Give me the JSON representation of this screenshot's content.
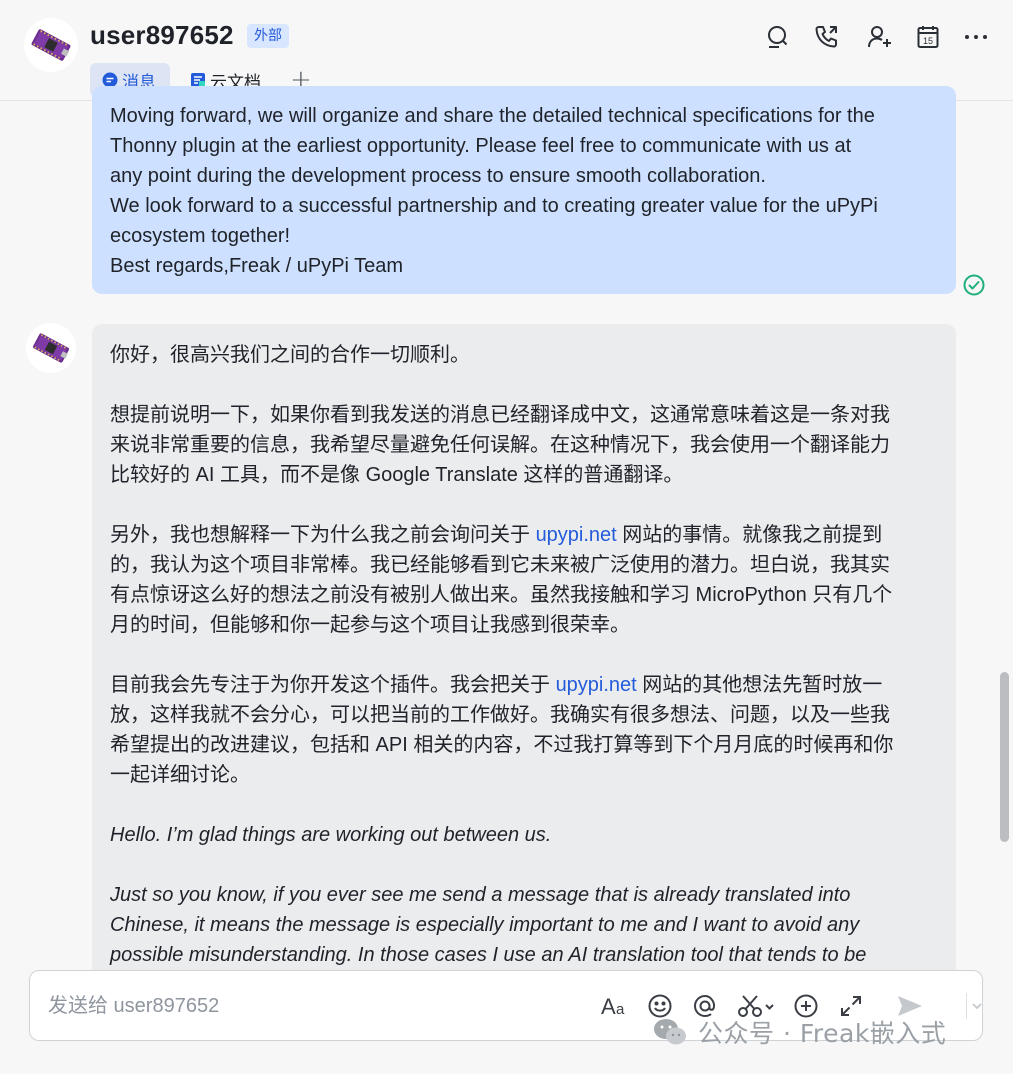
{
  "header": {
    "title": "user897652",
    "badge": "外部",
    "tabs": [
      {
        "label": "消息",
        "icon": "message-icon",
        "active": true
      },
      {
        "label": "云文档",
        "icon": "doc-icon",
        "active": false
      }
    ],
    "actions": [
      "search-icon",
      "phone-icon",
      "add-member-icon",
      "calendar-icon",
      "more-icon"
    ],
    "calendar_day": "15"
  },
  "own_message": {
    "lines": [
      "Moving forward, we will organize and share the detailed technical specifications for the",
      "Thonny plugin at the earliest opportunity. Please feel free to communicate with us at",
      "any point during the development process to ensure smooth collaboration.",
      "We look forward to a successful partnership and to creating greater value for the uPyPi",
      "ecosystem together!",
      "Best regards,Freak / uPyPi Team"
    ],
    "status": "read"
  },
  "other_message": {
    "p1": "你好，很高兴我们之间的合作一切顺利。",
    "p2_l1": "想提前说明一下，如果你看到我发送的消息已经翻译成中文，这通常意味着这是一条对我",
    "p2_l2": "来说非常重要的信息，我希望尽量避免任何误解。在这种情况下，我会使用一个翻译能力",
    "p2_l3": "比较好的 AI 工具，而不是像 Google Translate 这样的普通翻译。",
    "p3_l1_a": "另外，我也想解释一下为什么我之前会询问关于 ",
    "p3_l1_link": "upypi.net",
    "p3_l1_b": " 网站的事情。就像我之前提到",
    "p3_l2": "的，我认为这个项目非常棒。我已经能够看到它未来被广泛使用的潜力。坦白说，我其实",
    "p3_l3": "有点惊讶这么好的想法之前没有被别人做出来。虽然我接触和学习 MicroPython 只有几个",
    "p3_l4": "月的时间，但能够和你一起参与这个项目让我感到很荣幸。",
    "p4_l1_a": "目前我会先专注于为你开发这个插件。我会把关于 ",
    "p4_l1_link": "upypi.net",
    "p4_l1_b": " 网站的其他想法先暂时放一",
    "p4_l2": "放，这样我就不会分心，可以把当前的工作做好。我确实有很多想法、问题，以及一些我",
    "p4_l3": "希望提出的改进建议，包括和 API 相关的内容，不过我打算等到下个月月底的时候再和你",
    "p4_l4": "一起详细讨论。",
    "en_p1": "Hello. I’m glad things are working out between us.",
    "en_p2_l1": "Just so you know, if you ever see me send a message that is already translated into",
    "en_p2_l2": "Chinese, it means the message is especially important to me and I want to avoid any",
    "en_p2_l3": "possible misunderstanding. In those cases I use an AI translation tool that tends to be"
  },
  "composer": {
    "placeholder": "发送给 user897652",
    "tools": [
      "text-format-icon",
      "emoji-icon",
      "mention-icon",
      "screenshot-icon",
      "add-icon",
      "expand-icon",
      "send-icon",
      "chevron-down-icon"
    ]
  },
  "watermark": "公众号 · Freak嵌入式"
}
